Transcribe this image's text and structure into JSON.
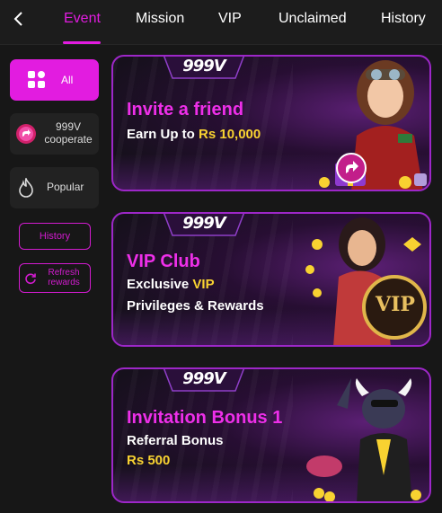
{
  "nav": {
    "back_icon": "chevron-left-icon",
    "tabs": [
      {
        "label": "Event",
        "active": true
      },
      {
        "label": "Mission",
        "active": false
      },
      {
        "label": "VIP",
        "active": false
      },
      {
        "label": "Unclaimed",
        "active": false
      },
      {
        "label": "History",
        "active": false
      }
    ]
  },
  "sidebar": {
    "items": [
      {
        "label": "All",
        "icon": "grid-icon",
        "selected": true
      },
      {
        "label": "999V\ncooperate",
        "icon": "share-arrow-icon",
        "selected": false
      },
      {
        "label": "Popular",
        "icon": "flame-icon",
        "selected": false
      }
    ],
    "history_label": "History",
    "refresh_label": "Refresh\nrewards",
    "refresh_icon": "refresh-icon"
  },
  "banners": [
    {
      "logo": "999V",
      "title": "Invite a friend",
      "line1_prefix": "Earn Up to ",
      "line1_highlight": "Rs 10,000"
    },
    {
      "logo": "999V",
      "title": "VIP Club",
      "line1_prefix": "Exclusive ",
      "line1_highlight": "VIP",
      "line2": "Privileges & Rewards",
      "badge": "VIP"
    },
    {
      "logo": "999V",
      "title": "Invitation Bonus 1",
      "line1": "Referral Bonus",
      "line2_highlight": "Rs 500"
    }
  ],
  "colors": {
    "accent": "#e21ce0",
    "highlight": "#f8d231",
    "background": "#171717",
    "banner_border": "#9d27c8"
  }
}
